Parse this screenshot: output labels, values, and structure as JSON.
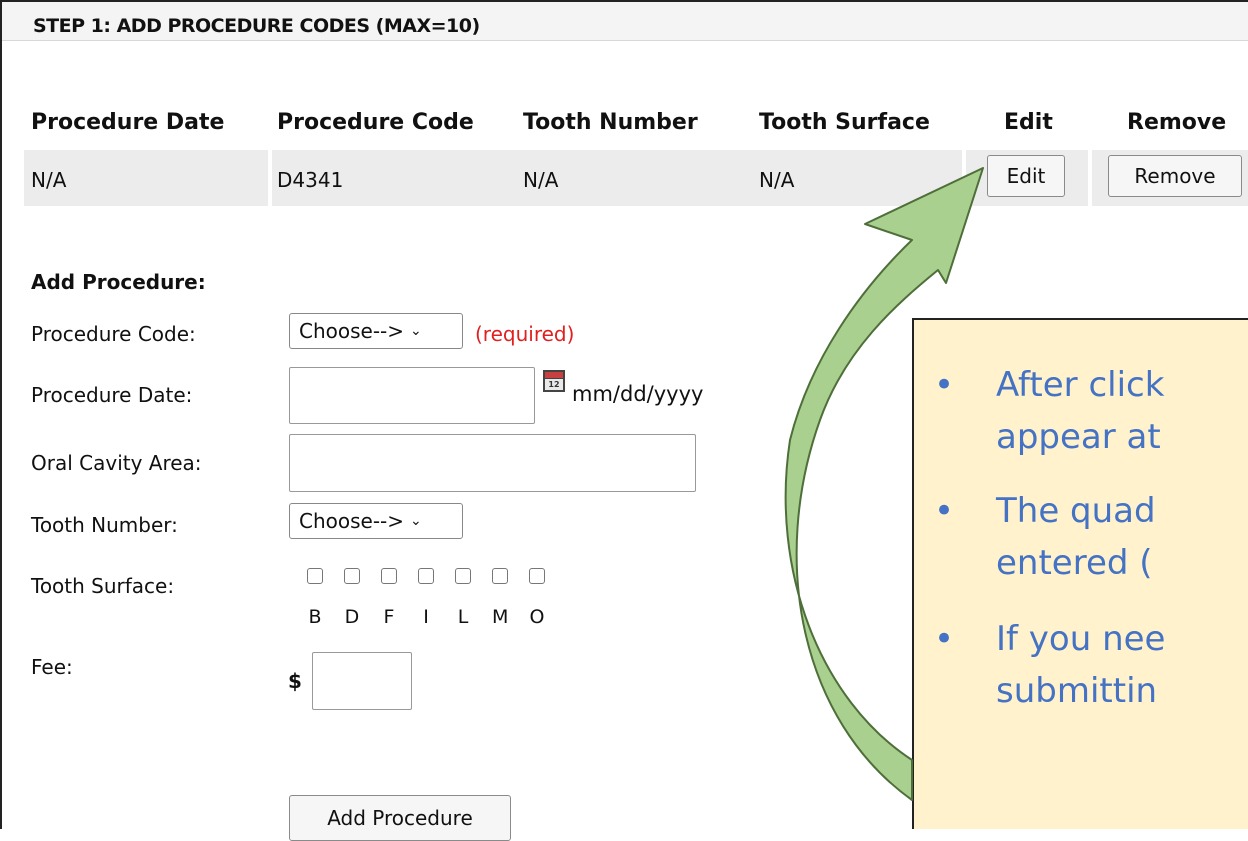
{
  "step": {
    "title": "STEP 1: ADD PROCEDURE CODES (MAX=10)"
  },
  "table": {
    "headers": [
      "Procedure Date",
      "Procedure Code",
      "Tooth Number",
      "Tooth Surface",
      "Edit",
      "Remove"
    ],
    "rows": [
      {
        "date": "N/A",
        "code": "D4341",
        "tooth_number": "N/A",
        "tooth_surface": "N/A",
        "edit_label": "Edit",
        "remove_label": "Remove"
      }
    ]
  },
  "add_procedure": {
    "heading": "Add Procedure:",
    "code_label": "Procedure Code:",
    "code_value": "Choose-->",
    "required_text": "(required)",
    "date_label": "Procedure Date:",
    "date_value": "",
    "date_format": "mm/dd/yyyy",
    "oral_label": "Oral Cavity Area:",
    "oral_value": "",
    "tooth_label": "Tooth Number:",
    "tooth_value": "Choose-->",
    "surface_label": "Tooth Surface:",
    "surfaces": [
      "B",
      "D",
      "F",
      "I",
      "L",
      "M",
      "O"
    ],
    "fee_label": "Fee:",
    "fee_currency": "$",
    "fee_value": "",
    "add_button": "Add Procedure"
  },
  "callout": {
    "bullets": [
      [
        "After click",
        "appear at"
      ],
      [
        "The quad",
        "entered ("
      ],
      [
        "If you nee",
        "submittin"
      ]
    ]
  },
  "colors": {
    "callout_bg": "#fff2cc",
    "callout_text": "#4472c4",
    "arrow_fill": "#a9d08e",
    "arrow_stroke": "#4e6e3a",
    "required": "#e02020"
  }
}
